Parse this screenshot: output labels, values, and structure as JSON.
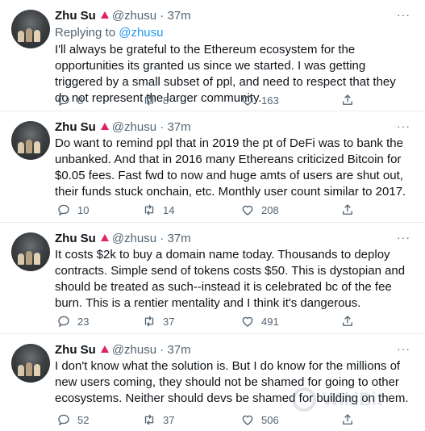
{
  "tweets": [
    {
      "name": "Zhu Su",
      "handle": "@zhusu",
      "dot": "·",
      "time": "37m",
      "more": "···",
      "replying_prefix": "Replying to ",
      "replying_to": "@zhusu",
      "text": "I'll always be grateful to the Ethereum ecosystem for the opportunities its granted us since we started. I was getting triggered by a small subset of ppl, and need to respect that they do not represent the larger community.",
      "replies": "8",
      "retweets": "8",
      "likes": "163"
    },
    {
      "name": "Zhu Su",
      "handle": "@zhusu",
      "dot": "·",
      "time": "37m",
      "more": "···",
      "text": "Do want to remind ppl that in 2019 the pt of DeFi was to bank the unbanked. And that in 2016 many Ethereans criticized Bitcoin for $0.05 fees. Fast fwd to now and huge amts of users are shut out, their funds stuck onchain, etc. Monthly user count similar to 2017.",
      "replies": "10",
      "retweets": "14",
      "likes": "208"
    },
    {
      "name": "Zhu Su",
      "handle": "@zhusu",
      "dot": "·",
      "time": "37m",
      "more": "···",
      "text": "It costs $2k to buy a domain name today. Thousands to deploy contracts. Simple send of tokens costs $50. This is dystopian and should be treated as such--instead it is celebrated bc of the fee burn. This is a rentier mentality and I think it's dangerous.",
      "replies": "23",
      "retweets": "37",
      "likes": "491"
    },
    {
      "name": "Zhu Su",
      "handle": "@zhusu",
      "dot": "·",
      "time": "37m",
      "more": "···",
      "text": "I don't know what the solution is. But I do know for the millions of new users coming, they should not be shamed for going to other ecosystems. Neither should devs be shamed for building on them.",
      "replies": "52",
      "retweets": "37",
      "likes": "506"
    }
  ],
  "watermark": {
    "text": "WikiBit"
  },
  "colors": {
    "accent": "#1d9bf0",
    "muted": "#536471",
    "text": "#0f1419",
    "flag": "#e0245e"
  }
}
